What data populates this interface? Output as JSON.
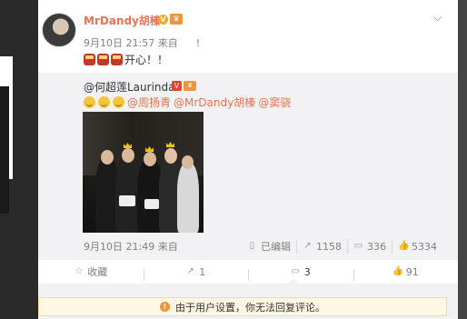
{
  "post": {
    "username": "MrDandy胡榛",
    "vip_badge": "V",
    "level_badge": "♛",
    "timestamp": "9月10日 21:57 来自",
    "source_suffix": "! ",
    "text": "开心！！"
  },
  "repost": {
    "author": "@何超莲Laurinda",
    "verified_badge": "V",
    "level_badge": "♛",
    "mention1": "@周扬青",
    "mention2": "@MrDandy胡榛",
    "mention3": "@窦骁",
    "timestamp": "9月10日 21:49 来自",
    "edited_label": "已编辑",
    "repost_count": "1158",
    "comment_count": "336",
    "like_count": "5334"
  },
  "actions": {
    "favorite_label": "收藏",
    "repost_count": "1",
    "comment_count": "3",
    "like_count": "91"
  },
  "notice": {
    "text": "由于用户设置，你无法回复评论。"
  },
  "colors": {
    "accent": "#eb7350",
    "repost_bg": "#f2f2f5",
    "notice_bg": "#fff6e4"
  },
  "icons": [
    "chevron-down-icon",
    "cake-emoji",
    "smile-emoji",
    "repost-icon",
    "comment-icon",
    "like-icon",
    "star-icon",
    "warning-icon"
  ]
}
